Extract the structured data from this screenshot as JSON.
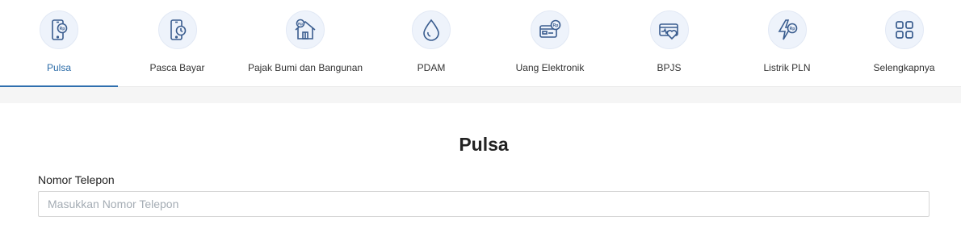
{
  "tabs": [
    {
      "label": "Pulsa",
      "icon": "phone-rp-icon",
      "active": true
    },
    {
      "label": "Pasca Bayar",
      "icon": "phone-clock-icon",
      "active": false
    },
    {
      "label": "Pajak Bumi dan Bangunan",
      "icon": "house-rp-icon",
      "active": false
    },
    {
      "label": "PDAM",
      "icon": "water-drop-icon",
      "active": false
    },
    {
      "label": "Uang Elektronik",
      "icon": "card-rp-icon",
      "active": false
    },
    {
      "label": "BPJS",
      "icon": "health-card-icon",
      "active": false
    },
    {
      "label": "Listrik PLN",
      "icon": "lightning-rp-icon",
      "active": false
    },
    {
      "label": "Selengkapnya",
      "icon": "grid-icon",
      "active": false
    }
  ],
  "form": {
    "title": "Pulsa",
    "phone_label": "Nomor Telepon",
    "phone_placeholder": "Masukkan Nomor Telepon",
    "phone_value": ""
  },
  "colors": {
    "accent": "#2f6fae",
    "icon_stroke": "#3a5d8f",
    "icon_bg": "#eef3fb"
  }
}
